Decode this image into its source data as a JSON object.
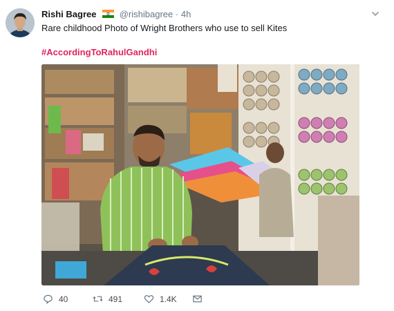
{
  "tweet": {
    "author_name": "Rishi Bagree",
    "handle": "@rishibagree",
    "separator": "·",
    "time": "4h",
    "text": "Rare childhood Photo of Wright Brothers who use to sell Kites",
    "hashtag": "#AccordingToRahulGandhi"
  },
  "actions": {
    "reply_count": "40",
    "retweet_count": "491",
    "like_count": "1.4K"
  },
  "icons": {
    "avatar": "avatar",
    "flag": "india-flag-icon",
    "caret": "chevron-down-icon",
    "reply": "reply-icon",
    "retweet": "retweet-icon",
    "like": "heart-icon",
    "dm": "envelope-icon"
  },
  "colors": {
    "hashtag": "#e0245e",
    "muted": "#657786",
    "text": "#14171a"
  }
}
